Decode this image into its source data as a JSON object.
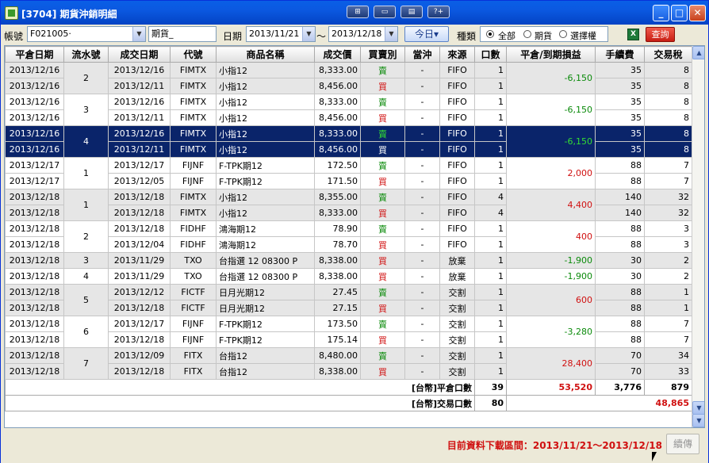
{
  "window": {
    "title": "[3704] 期貨沖銷明細",
    "tool_buttons": [
      "⊞",
      "▭",
      "▤",
      "?+"
    ],
    "minimize": "_",
    "maximize": "□",
    "close": "✕"
  },
  "toolbar": {
    "account_label": "帳號",
    "account_value": "F021005·",
    "category_value": "期貨_",
    "date_label": "日期",
    "date_from": "2013/11/21",
    "date_sep": "～",
    "date_to": "2013/12/18",
    "today_label": "今日▾",
    "kind_label": "種類",
    "radio_all": "全部",
    "radio_futures": "期貨",
    "radio_options": "選擇權",
    "excel_icon": "X",
    "query_label": "查詢"
  },
  "table": {
    "headers": [
      "平倉日期",
      "流水號",
      "成交日期",
      "代號",
      "商品名稱",
      "成交價",
      "買賣別",
      "當沖",
      "來源",
      "口數",
      "平倉/到期損益",
      "手續費",
      "交易稅"
    ],
    "groups": [
      {
        "serial": "2",
        "pl": "-6,150",
        "pl_sign": "neg",
        "shade": "g",
        "rows": [
          {
            "close_date": "2013/12/16",
            "trade_date": "2013/12/16",
            "code": "FIMTX",
            "name": "小指12",
            "price": "8,333.00",
            "side": "賣",
            "side_type": "buy",
            "daytrade": "-",
            "source": "FIFO",
            "qty": "1",
            "fee": "35",
            "tax": "8"
          },
          {
            "close_date": "2013/12/16",
            "trade_date": "2013/12/11",
            "code": "FIMTX",
            "name": "小指12",
            "price": "8,456.00",
            "side": "買",
            "side_type": "sell",
            "daytrade": "-",
            "source": "FIFO",
            "qty": "1",
            "fee": "35",
            "tax": "8"
          }
        ]
      },
      {
        "serial": "3",
        "pl": "-6,150",
        "pl_sign": "neg",
        "shade": "w",
        "rows": [
          {
            "close_date": "2013/12/16",
            "trade_date": "2013/12/16",
            "code": "FIMTX",
            "name": "小指12",
            "price": "8,333.00",
            "side": "賣",
            "side_type": "buy",
            "daytrade": "-",
            "source": "FIFO",
            "qty": "1",
            "fee": "35",
            "tax": "8"
          },
          {
            "close_date": "2013/12/16",
            "trade_date": "2013/12/11",
            "code": "FIMTX",
            "name": "小指12",
            "price": "8,456.00",
            "side": "買",
            "side_type": "sell",
            "daytrade": "-",
            "source": "FIFO",
            "qty": "1",
            "fee": "35",
            "tax": "8"
          }
        ]
      },
      {
        "serial": "4",
        "pl": "-6,150",
        "pl_sign": "neg",
        "shade": "sel",
        "rows": [
          {
            "close_date": "2013/12/16",
            "trade_date": "2013/12/16",
            "code": "FIMTX",
            "name": "小指12",
            "price": "8,333.00",
            "side": "賣",
            "side_type": "buy",
            "daytrade": "-",
            "source": "FIFO",
            "qty": "1",
            "fee": "35",
            "tax": "8"
          },
          {
            "close_date": "2013/12/16",
            "trade_date": "2013/12/11",
            "code": "FIMTX",
            "name": "小指12",
            "price": "8,456.00",
            "side": "買",
            "side_type": "sell",
            "daytrade": "-",
            "source": "FIFO",
            "qty": "1",
            "fee": "35",
            "tax": "8"
          }
        ]
      },
      {
        "serial": "1",
        "pl": "2,000",
        "pl_sign": "pos",
        "shade": "w",
        "rows": [
          {
            "close_date": "2013/12/17",
            "trade_date": "2013/12/17",
            "code": "FIJNF",
            "name": "F-TPK期12",
            "price": "172.50",
            "side": "賣",
            "side_type": "buy",
            "daytrade": "-",
            "source": "FIFO",
            "qty": "1",
            "fee": "88",
            "tax": "7"
          },
          {
            "close_date": "2013/12/17",
            "trade_date": "2013/12/05",
            "code": "FIJNF",
            "name": "F-TPK期12",
            "price": "171.50",
            "side": "買",
            "side_type": "sell",
            "daytrade": "-",
            "source": "FIFO",
            "qty": "1",
            "fee": "88",
            "tax": "7"
          }
        ]
      },
      {
        "serial": "1",
        "pl": "4,400",
        "pl_sign": "pos",
        "shade": "g",
        "rows": [
          {
            "close_date": "2013/12/18",
            "trade_date": "2013/12/18",
            "code": "FIMTX",
            "name": "小指12",
            "price": "8,355.00",
            "side": "賣",
            "side_type": "buy",
            "daytrade": "-",
            "source": "FIFO",
            "qty": "4",
            "fee": "140",
            "tax": "32"
          },
          {
            "close_date": "2013/12/18",
            "trade_date": "2013/12/18",
            "code": "FIMTX",
            "name": "小指12",
            "price": "8,333.00",
            "side": "買",
            "side_type": "sell",
            "daytrade": "-",
            "source": "FIFO",
            "qty": "4",
            "fee": "140",
            "tax": "32"
          }
        ]
      },
      {
        "serial": "2",
        "pl": "400",
        "pl_sign": "pos",
        "shade": "w",
        "rows": [
          {
            "close_date": "2013/12/18",
            "trade_date": "2013/12/18",
            "code": "FIDHF",
            "name": "鴻海期12",
            "price": "78.90",
            "side": "賣",
            "side_type": "buy",
            "daytrade": "-",
            "source": "FIFO",
            "qty": "1",
            "fee": "88",
            "tax": "3"
          },
          {
            "close_date": "2013/12/18",
            "trade_date": "2013/12/04",
            "code": "FIDHF",
            "name": "鴻海期12",
            "price": "78.70",
            "side": "買",
            "side_type": "sell",
            "daytrade": "-",
            "source": "FIFO",
            "qty": "1",
            "fee": "88",
            "tax": "3"
          }
        ]
      },
      {
        "serial": "3",
        "pl": "-1,900",
        "pl_sign": "neg",
        "shade": "g",
        "rows": [
          {
            "close_date": "2013/12/18",
            "trade_date": "2013/11/29",
            "code": "TXO",
            "name": "台指選 12 08300 P",
            "price": "8,338.00",
            "side": "買",
            "side_type": "sell",
            "daytrade": "-",
            "source": "放棄",
            "qty": "1",
            "fee": "30",
            "tax": "2"
          }
        ]
      },
      {
        "serial": "4",
        "pl": "-1,900",
        "pl_sign": "neg",
        "shade": "w",
        "rows": [
          {
            "close_date": "2013/12/18",
            "trade_date": "2013/11/29",
            "code": "TXO",
            "name": "台指選 12 08300 P",
            "price": "8,338.00",
            "side": "買",
            "side_type": "sell",
            "daytrade": "-",
            "source": "放棄",
            "qty": "1",
            "fee": "30",
            "tax": "2"
          }
        ]
      },
      {
        "serial": "5",
        "pl": "600",
        "pl_sign": "pos",
        "shade": "g",
        "rows": [
          {
            "close_date": "2013/12/18",
            "trade_date": "2013/12/12",
            "code": "FICTF",
            "name": "日月光期12",
            "price": "27.45",
            "side": "賣",
            "side_type": "buy",
            "daytrade": "-",
            "source": "交割",
            "qty": "1",
            "fee": "88",
            "tax": "1"
          },
          {
            "close_date": "2013/12/18",
            "trade_date": "2013/12/18",
            "code": "FICTF",
            "name": "日月光期12",
            "price": "27.15",
            "side": "買",
            "side_type": "sell",
            "daytrade": "-",
            "source": "交割",
            "qty": "1",
            "fee": "88",
            "tax": "1"
          }
        ]
      },
      {
        "serial": "6",
        "pl": "-3,280",
        "pl_sign": "neg",
        "shade": "w",
        "rows": [
          {
            "close_date": "2013/12/18",
            "trade_date": "2013/12/17",
            "code": "FIJNF",
            "name": "F-TPK期12",
            "price": "173.50",
            "side": "賣",
            "side_type": "buy",
            "daytrade": "-",
            "source": "交割",
            "qty": "1",
            "fee": "88",
            "tax": "7"
          },
          {
            "close_date": "2013/12/18",
            "trade_date": "2013/12/18",
            "code": "FIJNF",
            "name": "F-TPK期12",
            "price": "175.14",
            "side": "買",
            "side_type": "sell",
            "daytrade": "-",
            "source": "交割",
            "qty": "1",
            "fee": "88",
            "tax": "7"
          }
        ]
      },
      {
        "serial": "7",
        "pl": "28,400",
        "pl_sign": "pos",
        "shade": "g",
        "rows": [
          {
            "close_date": "2013/12/18",
            "trade_date": "2013/12/09",
            "code": "FITX",
            "name": "台指12",
            "price": "8,480.00",
            "side": "賣",
            "side_type": "buy",
            "daytrade": "-",
            "source": "交割",
            "qty": "1",
            "fee": "70",
            "tax": "34"
          },
          {
            "close_date": "2013/12/18",
            "trade_date": "2013/12/18",
            "code": "FITX",
            "name": "台指12",
            "price": "8,338.00",
            "side": "買",
            "side_type": "sell",
            "daytrade": "-",
            "source": "交割",
            "qty": "1",
            "fee": "70",
            "tax": "33"
          }
        ]
      }
    ],
    "summary": {
      "close_label": "[台幣]平倉口數",
      "close_qty": "39",
      "close_pl": "53,520",
      "close_fee": "3,776",
      "close_tax": "879",
      "trade_label": "[台幣]交易口數",
      "trade_qty": "80",
      "trade_total": "48,865"
    }
  },
  "scrollbar": {
    "up": "▲",
    "down": "▼"
  },
  "status": {
    "range_text": "目前資料下載區間：2013/11/21～2013/12/18",
    "continue_label": "續傳"
  },
  "colors": {
    "accent": "#0a5fe6",
    "buy": "#0a8a0a",
    "sell": "#d01010",
    "selected": "#0a246a"
  }
}
